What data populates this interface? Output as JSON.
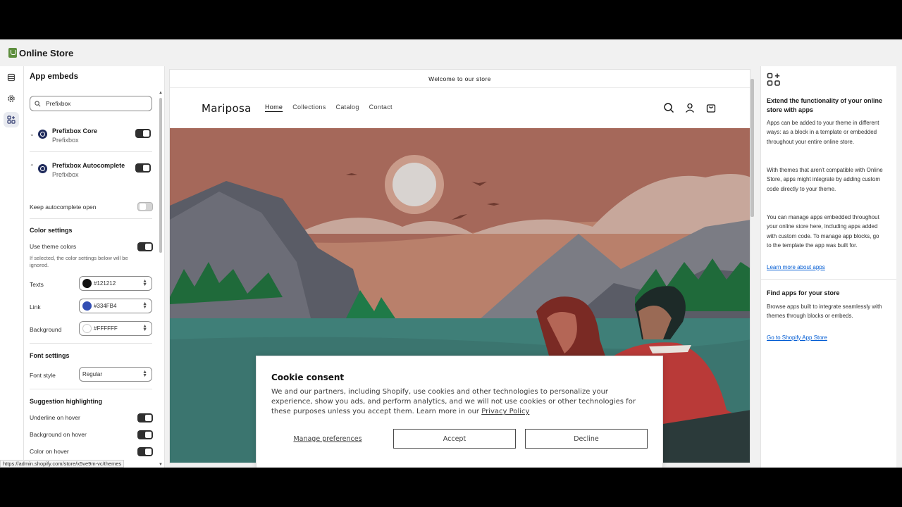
{
  "topbar": {
    "title": "Online Store"
  },
  "sidebar": {
    "header": "App embeds",
    "search": {
      "value": "Prefixbox"
    },
    "apps": [
      {
        "name": "Prefixbox Core",
        "vendor": "Prefixbox",
        "enabled": true
      },
      {
        "name": "Prefixbox Autocomplete",
        "vendor": "Prefixbox",
        "enabled": true
      }
    ],
    "keep_open_label": "Keep autocomplete open",
    "color_settings": {
      "title": "Color settings",
      "use_theme_label": "Use theme colors",
      "hint": "If selected, the color settings below will be ignored.",
      "texts_label": "Texts",
      "texts_value": "#121212",
      "link_label": "Link",
      "link_value": "#334FB4",
      "bg_label": "Background",
      "bg_value": "#FFFFFF"
    },
    "font_settings": {
      "title": "Font settings",
      "style_label": "Font style",
      "style_value": "Regular"
    },
    "suggestion": {
      "title": "Suggestion highlighting",
      "underline_label": "Underline on hover",
      "bg_label": "Background on hover",
      "color_label": "Color on hover"
    },
    "status_url": "https://admin.shopify.com/store/x5ve9m-vc/themes"
  },
  "preview": {
    "announcement": "Welcome to our store",
    "brand": "Mariposa",
    "nav": [
      "Home",
      "Collections",
      "Catalog",
      "Contact"
    ],
    "cookie": {
      "title": "Cookie consent",
      "body": "We and our partners, including Shopify, use cookies and other technologies to personalize your experience, show you ads, and perform analytics, and we will not use cookies or other technologies for these purposes unless you accept them. Learn more in our ",
      "policy_link": "Privacy Policy",
      "manage": "Manage preferences",
      "accept": "Accept",
      "decline": "Decline"
    }
  },
  "right_panel": {
    "heading": "Extend the functionality of your online store with apps",
    "p1": "Apps can be added to your theme in different ways: as a block in a template or embedded throughout your entire online store.",
    "p2": "With themes that aren't compatible with Online Store, apps might integrate by adding custom code directly to your theme.",
    "p3": "You can manage apps embedded throughout your online store here, including apps added with custom code. To manage app blocks, go to the template the app was built for.",
    "learn_link": "Learn more about apps",
    "find_heading": "Find apps for your store",
    "find_p": "Browse apps built to integrate seamlessly with themes through blocks or embeds.",
    "store_link": "Go to Shopify App Store"
  },
  "colors": {
    "link_swatch": "#334FB4",
    "text_swatch": "#121212",
    "toggle_on": "#303030"
  }
}
